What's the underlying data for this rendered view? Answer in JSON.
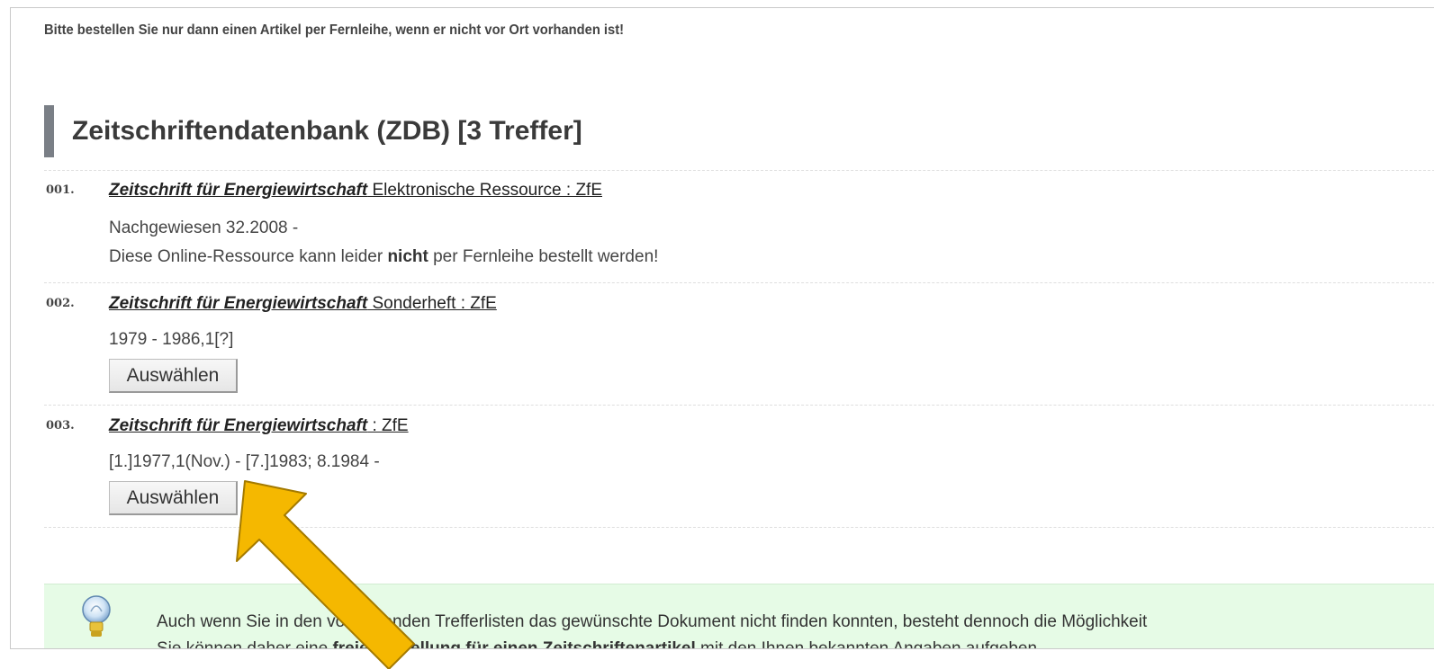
{
  "notice": "Bitte bestellen Sie nur dann einen Artikel per Fernleihe, wenn er nicht vor Ort vorhanden ist!",
  "section_title": "Zeitschriftendatenbank (ZDB) [3 Treffer]",
  "results": [
    {
      "number": "001.",
      "title_main": "Zeitschrift für Energiewirtschaft",
      "title_rest": " Elektronische Ressource : ZfE",
      "holdings": "Nachgewiesen 32.2008 -",
      "note_before": "Diese Online-Ressource kann leider ",
      "note_bold": "nicht",
      "note_after": " per Fernleihe bestellt werden!"
    },
    {
      "number": "002.",
      "title_main": "Zeitschrift für Energiewirtschaft",
      "title_rest": " Sonderheft : ZfE",
      "holdings": "1979 - 1986,1[?]",
      "button_label": "Auswählen"
    },
    {
      "number": "003.",
      "title_main": "Zeitschrift für Energiewirtschaft",
      "title_rest": " : ZfE",
      "holdings": "[1.]1977,1(Nov.) - [7.]1983; 8.1984 -",
      "button_label": "Auswählen"
    }
  ],
  "info": {
    "line1": "Auch wenn Sie in den vorstehenden Trefferlisten das gewünschte Dokument nicht finden konnten, besteht dennoch die Möglichkeit",
    "line2_before": "Sie können daher eine ",
    "line2_bold1": "freie Bestellung",
    "line2_mid": " ",
    "line2_bold2": "für einen Zeitschriftenartikel",
    "line2_after": " mit den Ihnen bekannten Angaben aufgeben."
  },
  "colors": {
    "section_bar": "#7a7f86",
    "info_background": "#e6fbe6",
    "annotation_arrow": "#f5b800"
  }
}
